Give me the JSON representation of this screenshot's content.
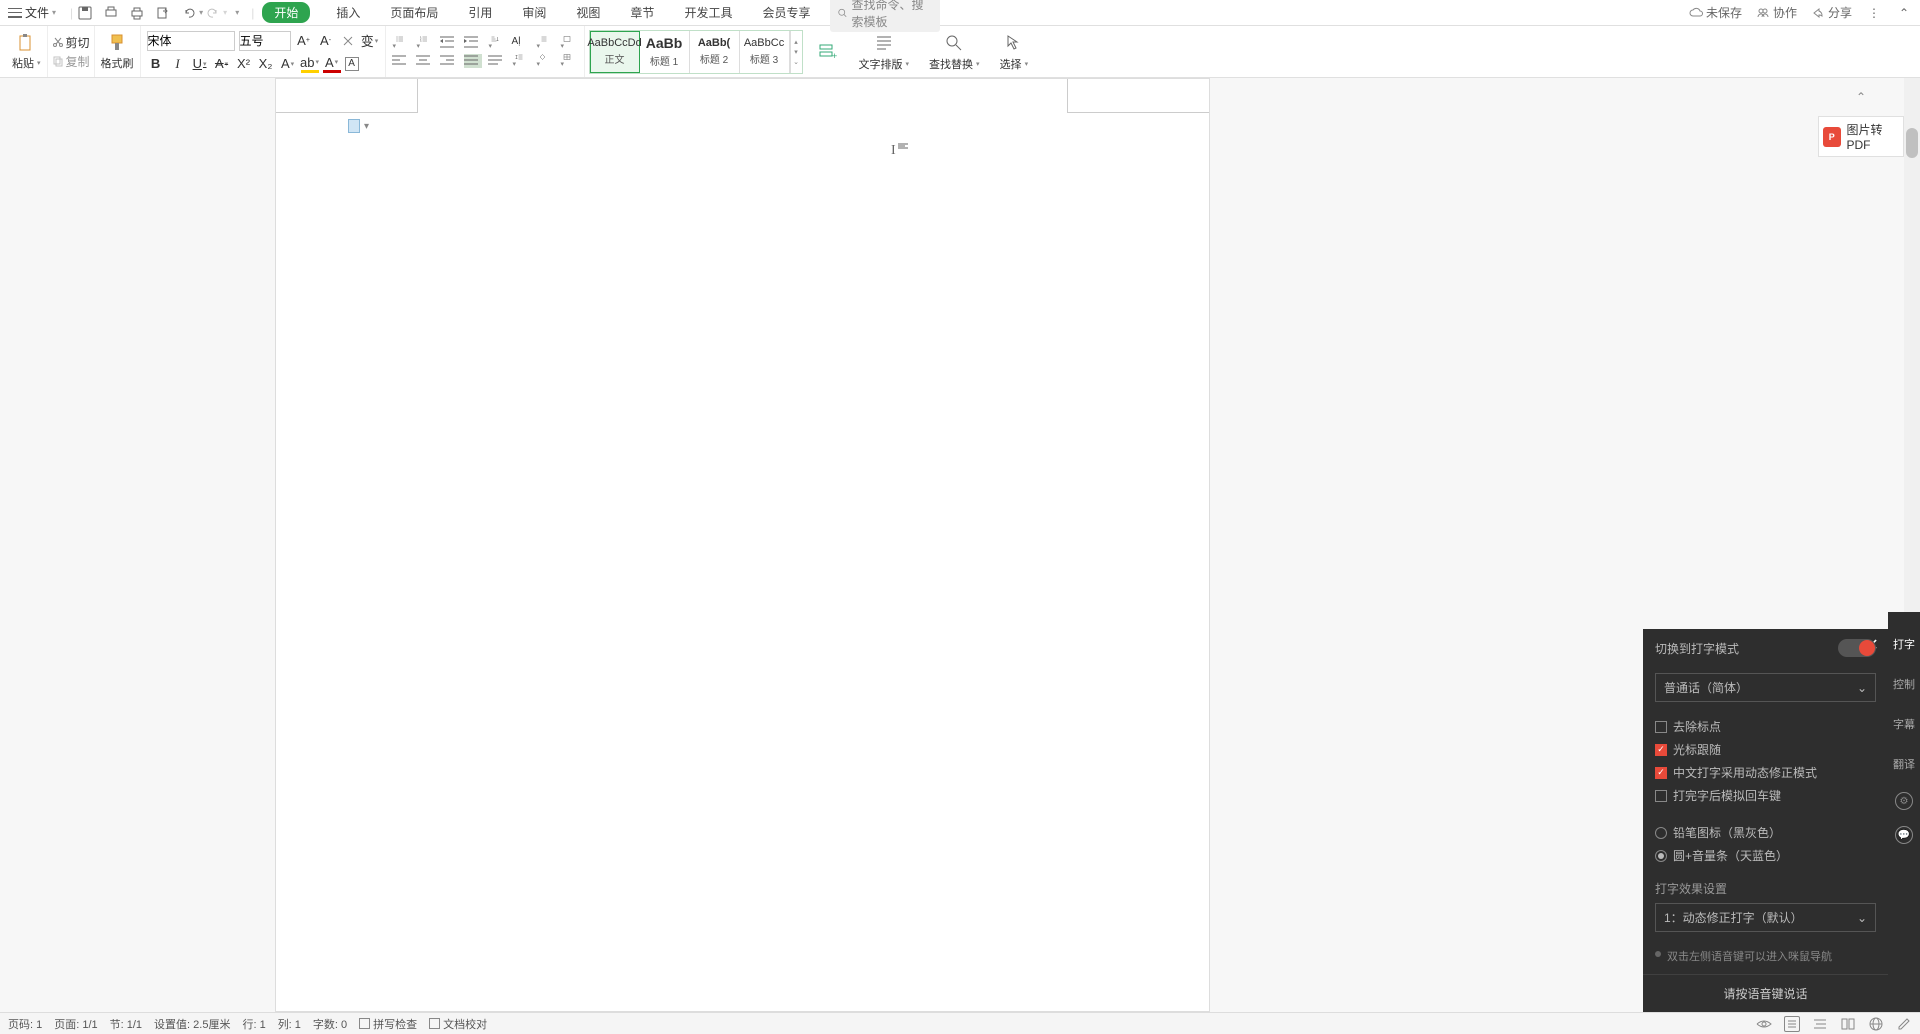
{
  "menu": {
    "file": "文件"
  },
  "tabs": [
    "开始",
    "插入",
    "页面布局",
    "引用",
    "审阅",
    "视图",
    "章节",
    "开发工具",
    "会员专享"
  ],
  "search_placeholder": "查找命令、搜索模板",
  "top_right": {
    "unsaved": "未保存",
    "collab": "协作",
    "share": "分享"
  },
  "clipboard": {
    "paste": "粘贴",
    "cut": "剪切",
    "copy": "复制",
    "brush": "格式刷"
  },
  "font": {
    "name": "宋体",
    "size": "五号"
  },
  "styles": [
    {
      "preview": "AaBbCcDd",
      "name": "正文"
    },
    {
      "preview": "AaBb",
      "name": "标题 1"
    },
    {
      "preview": "AaBb(",
      "name": "标题 2"
    },
    {
      "preview": "AaBbCc",
      "name": "标题 3"
    }
  ],
  "ribbon_big": {
    "typeset": "文字排版",
    "find": "查找替换",
    "select": "选择"
  },
  "side": {
    "pdf": "图片转PDF"
  },
  "status": {
    "page_num": "页码: 1",
    "page": "页面: 1/1",
    "sec": "节: 1/1",
    "pos": "设置值: 2.5厘米",
    "line": "行: 1",
    "col": "列: 1",
    "words": "字数: 0",
    "spell": "拼写检查",
    "proof": "文档校对"
  },
  "voice": {
    "title": "切换到打字模式",
    "lang": "普通话（简体）",
    "chk1": "去除标点",
    "chk2": "光标跟随",
    "chk3": "中文打字采用动态修正模式",
    "chk4": "打完字后模拟回车键",
    "r1": "铅笔图标（黑灰色）",
    "r2": "圆+音量条（天蓝色）",
    "effect_label": "打字效果设置",
    "effect": "1：动态修正打字（默认）",
    "tip": "双击左侧语音键可以进入咪鼠导航",
    "prompt": "请按语音键说话",
    "tabs": [
      "打字",
      "控制",
      "字幕",
      "翻译"
    ]
  }
}
